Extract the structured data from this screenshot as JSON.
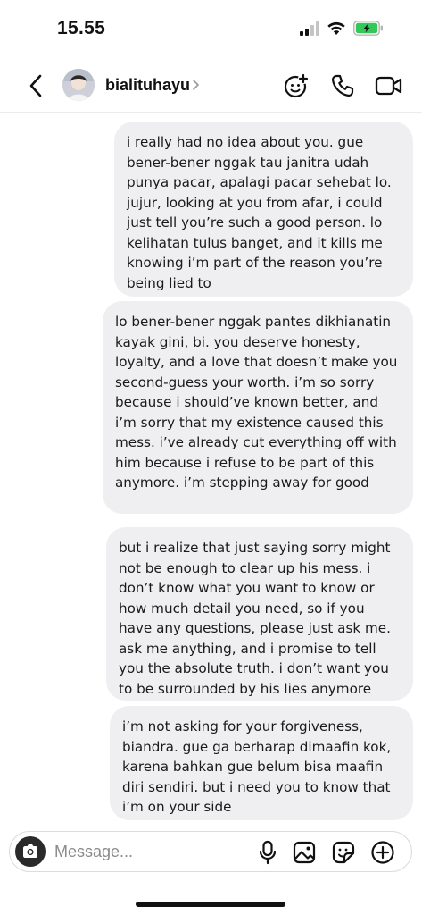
{
  "status_bar": {
    "time": "15.55",
    "battery_color": "#34c759"
  },
  "header": {
    "username": "bialituhayu",
    "icons": [
      "back-icon",
      "sticker-call-icon",
      "phone-icon",
      "video-icon"
    ]
  },
  "messages": [
    {
      "text": "i really had no idea about you. gue bener-bener nggak tau janitra udah punya pacar, apalagi pacar sehebat lo. jujur, looking at you from afar, i could just tell you’re such a good person. lo kelihatan tulus banget, and it kills me knowing i’m part of the reason you’re being lied to"
    },
    {
      "text": "lo bener-bener nggak pantes dikhianatin kayak gini, bi. you deserve honesty, loyalty, and a love that doesn’t make you second-guess your worth. i’m so sorry because i should’ve known better, and i’m sorry that my existence caused this mess. i’ve already cut everything off with him because i refuse to be part of this anymore. i’m stepping away for good"
    },
    {
      "text": "but i realize that just saying sorry might not be enough to clear up his mess. i don’t know what you want to know or how much detail you need, so if you have any questions, please just ask me. ask me anything, and i promise to tell you the absolute truth. i don’t want you to be surrounded by his lies anymore"
    },
    {
      "text": "i’m not asking for your forgiveness, biandra. gue ga berharap dimaafin kok, karena bahkan gue belum bisa maafin diri sendiri. but i need you to know that i’m on your side"
    }
  ],
  "composer": {
    "placeholder": "Message...",
    "icons": [
      "camera-icon",
      "microphone-icon",
      "gallery-icon",
      "sticker-icon",
      "add-icon"
    ]
  }
}
